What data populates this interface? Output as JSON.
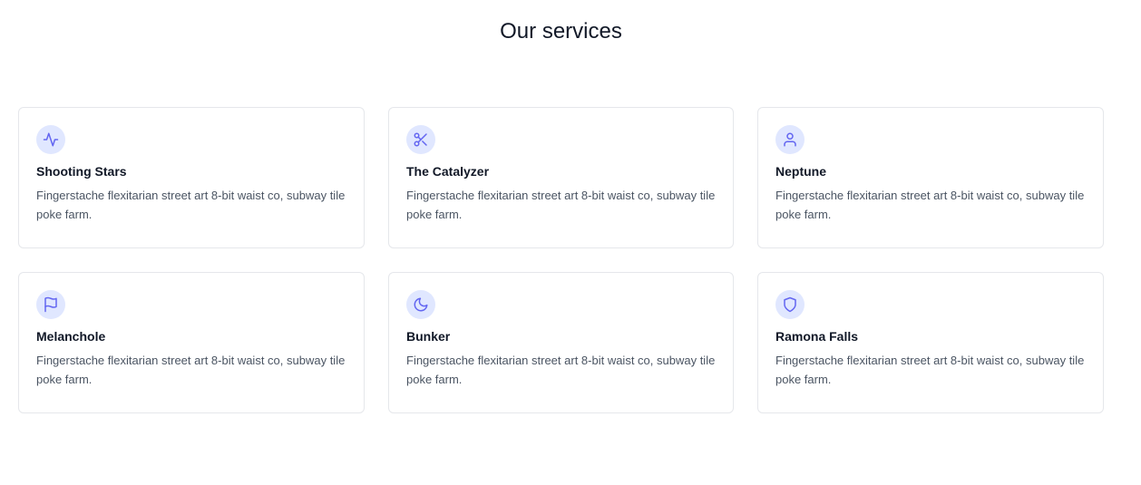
{
  "section": {
    "title": "Our services"
  },
  "services": [
    {
      "icon": "activity-icon",
      "title": "Shooting Stars",
      "text": "Fingerstache flexitarian street art 8-bit waist co, subway tile poke farm."
    },
    {
      "icon": "scissors-icon",
      "title": "The Catalyzer",
      "text": "Fingerstache flexitarian street art 8-bit waist co, subway tile poke farm."
    },
    {
      "icon": "user-icon",
      "title": "Neptune",
      "text": "Fingerstache flexitarian street art 8-bit waist co, subway tile poke farm."
    },
    {
      "icon": "flag-icon",
      "title": "Melanchole",
      "text": "Fingerstache flexitarian street art 8-bit waist co, subway tile poke farm."
    },
    {
      "icon": "moon-icon",
      "title": "Bunker",
      "text": "Fingerstache flexitarian street art 8-bit waist co, subway tile poke farm."
    },
    {
      "icon": "shield-icon",
      "title": "Ramona Falls",
      "text": "Fingerstache flexitarian street art 8-bit waist co, subway tile poke farm."
    }
  ],
  "colors": {
    "accent": "#6366f1",
    "icon_background": "#e0e7ff",
    "card_border": "#e5e7eb",
    "heading": "#111827",
    "body_text": "#4b5563"
  }
}
